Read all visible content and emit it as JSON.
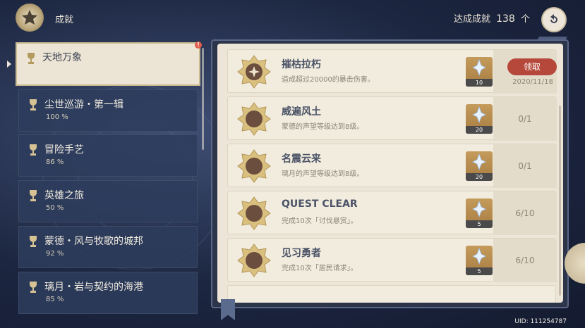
{
  "header": {
    "title": "成就",
    "total_label": "达成成就",
    "total_count": "138",
    "total_unit": "个"
  },
  "sidebar": {
    "items": [
      {
        "name": "天地万象",
        "percent": "",
        "active": true,
        "notification": "!"
      },
      {
        "name": "尘世巡游・第一辑",
        "percent": "100 %"
      },
      {
        "name": "冒险手艺",
        "percent": "86 %"
      },
      {
        "name": "英雄之旅",
        "percent": "50 %"
      },
      {
        "name": "蒙德・风与牧歌的城邦",
        "percent": "92 %"
      },
      {
        "name": "璃月・岩与契约的海港",
        "percent": "85 %"
      }
    ]
  },
  "achievements": [
    {
      "title": "摧枯拉朽",
      "desc": "造成超过20000的暴击伤害。",
      "reward_count": "10",
      "status": "",
      "claim_label": "领取",
      "date": "2020/11/18"
    },
    {
      "title": "威遍风土",
      "desc": "蒙德的声望等级达到8级。",
      "reward_count": "20",
      "status": "0/1"
    },
    {
      "title": "名震云来",
      "desc": "璃月的声望等级达到8级。",
      "reward_count": "20",
      "status": "0/1"
    },
    {
      "title": "QUEST CLEAR",
      "desc": "完成10次「讨伐悬赏」。",
      "reward_count": "5",
      "status": "6/10"
    },
    {
      "title": "见习勇者",
      "desc": "完成10次「居民请求」。",
      "reward_count": "5",
      "status": "6/10"
    }
  ],
  "footer": {
    "uid": "UID: 111254787"
  },
  "icons": {
    "emblem": "achievement-emblem-icon",
    "back": "back-arrow-icon",
    "medal": "achievement-medal-icon",
    "reward": "primogem-icon"
  },
  "colors": {
    "claim_button": "#b5483a",
    "notification": "#e25a4a",
    "panel_bg": "#ece5d8"
  }
}
